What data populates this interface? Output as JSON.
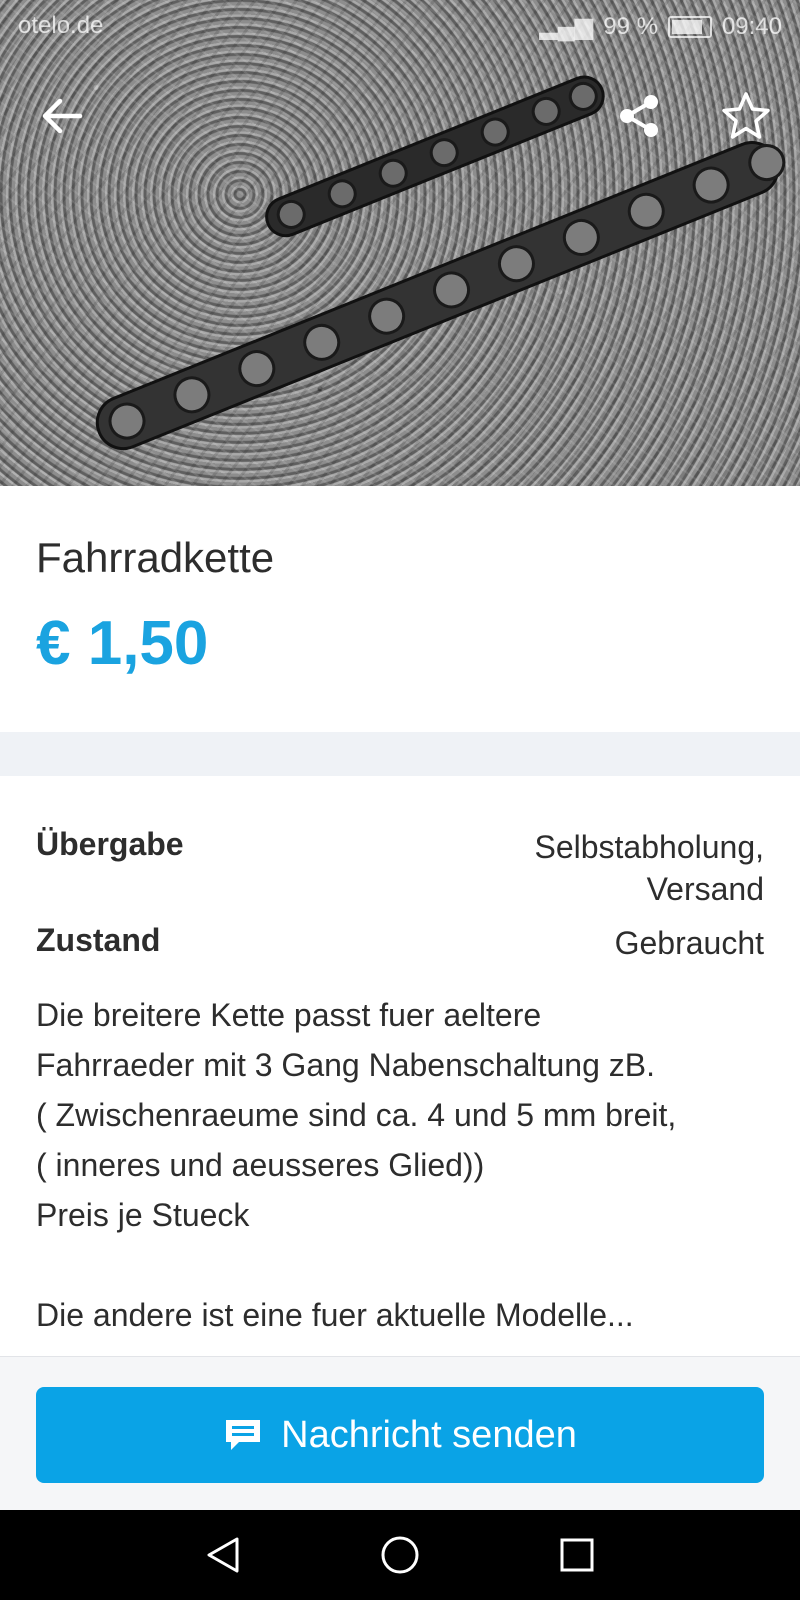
{
  "status_bar": {
    "carrier": "otelo.de",
    "battery": "99 %",
    "time": "09:40"
  },
  "hero": {
    "icons": [
      "arrow-left-icon",
      "share-icon",
      "star-outline-icon"
    ]
  },
  "listing": {
    "title": "Fahrradkette",
    "price": "€ 1,50"
  },
  "details": {
    "uebergabe_label": "Übergabe",
    "uebergabe_value_line1": "Selbstabholung,",
    "uebergabe_value_line2": "Versand",
    "zustand_label": "Zustand",
    "zustand_value": "Gebraucht"
  },
  "description": {
    "line1": "Die breitere Kette passt fuer aeltere",
    "line2": "Fahrraeder mit 3 Gang Nabenschaltung zB.",
    "line3": "( Zwischenraeume sind ca. 4 und 5 mm breit,",
    "line4": "( inneres und aeusseres Glied))",
    "line5": "Preis je Stueck",
    "line6": "Die andere ist eine fuer aktuelle Modelle..."
  },
  "action": {
    "send_label": "Nachricht senden",
    "icon": "chat-bubble-icon"
  },
  "colors": {
    "accent": "#1aa3e0",
    "button": "#0aa3e6",
    "navbar": "#000000"
  }
}
